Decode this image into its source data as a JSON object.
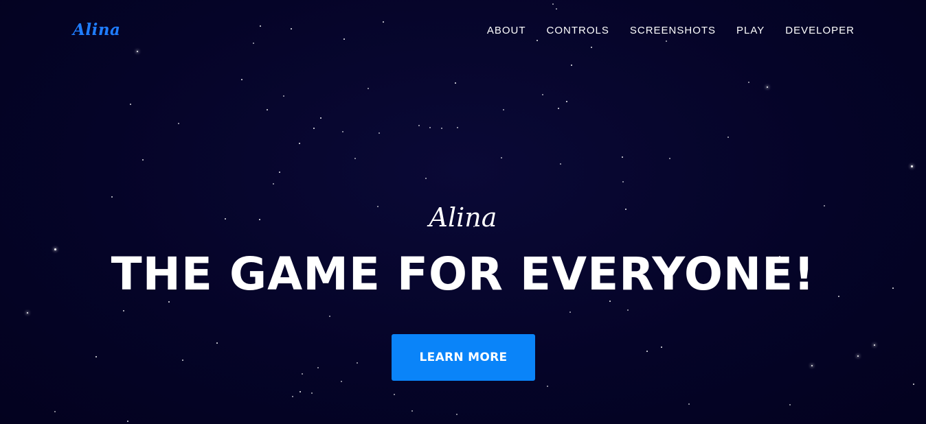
{
  "navbar": {
    "brand": "Alina",
    "links": [
      {
        "label": "ABOUT"
      },
      {
        "label": "CONTROLS"
      },
      {
        "label": "SCREENSHOTS"
      },
      {
        "label": "PLAY"
      },
      {
        "label": "DEVELOPER"
      }
    ]
  },
  "hero": {
    "subtitle": "Alina",
    "headline": "THE GAME FOR EVERYONE!",
    "cta_label": "LEARN MORE"
  },
  "colors": {
    "background": "#04032a",
    "brand": "#1f7dff",
    "button": "#0a84f9",
    "text": "#ffffff"
  }
}
